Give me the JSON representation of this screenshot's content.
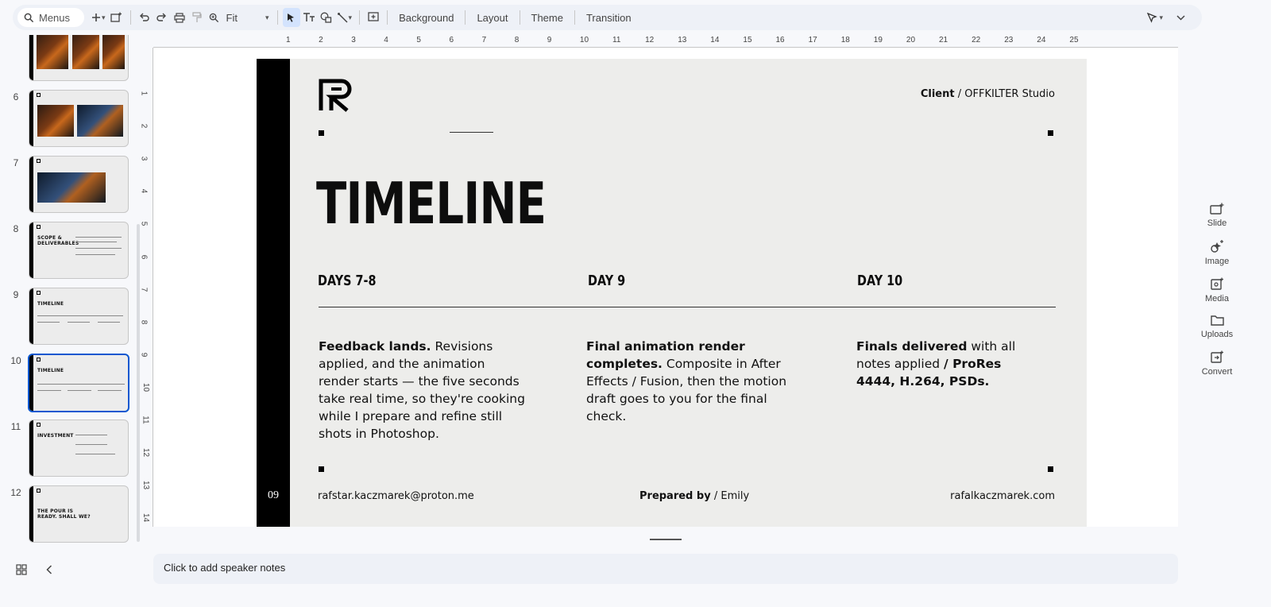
{
  "toolbar": {
    "search_label": "Menus",
    "zoom_value": "Fit",
    "buttons": [
      "Background",
      "Layout",
      "Theme",
      "Transition"
    ]
  },
  "filmstrip": {
    "slides": [
      {
        "number": "",
        "title": ""
      },
      {
        "number": "6",
        "title": ""
      },
      {
        "number": "7",
        "title": ""
      },
      {
        "number": "8",
        "title": "SCOPE & DELIVERABLES"
      },
      {
        "number": "9",
        "title": "TIMELINE"
      },
      {
        "number": "10",
        "title": "TIMELINE"
      },
      {
        "number": "11",
        "title": "INVESTMENT"
      },
      {
        "number": "12",
        "title": "THE POUR IS READY. SHALL WE?"
      }
    ],
    "selected_index": 5
  },
  "ruler": {
    "h": [
      "1",
      "2",
      "3",
      "4",
      "5",
      "6",
      "7",
      "8",
      "9",
      "10",
      "11",
      "12",
      "13",
      "14",
      "15",
      "16",
      "17",
      "18",
      "19",
      "20",
      "21",
      "22",
      "23",
      "24",
      "25"
    ],
    "v": [
      "1",
      "2",
      "3",
      "4",
      "5",
      "6",
      "7",
      "8",
      "9",
      "10",
      "11",
      "12",
      "13",
      "14"
    ]
  },
  "slide": {
    "page_number": "09",
    "client_label": "Client",
    "client_sep": "/",
    "client_name": "OFFKILTER Studio",
    "title": "TIMELINE",
    "columns": [
      {
        "heading": "DAYS 7-8",
        "lead": "Feedback lands.",
        "body": " Revisions applied, and the animation render starts — the five seconds take real time, so they're cooking while I prepare and refine still shots in Photoshop.",
        "tail": ""
      },
      {
        "heading": "DAY 9",
        "lead": "Final animation render completes.",
        "body": " Composite in After Effects / Fusion, then the motion draft goes to you for the final check.",
        "tail": ""
      },
      {
        "heading": "DAY 10",
        "lead": "Finals delivered",
        "body": " with all notes applied ",
        "tail": "/ ProRes 4444, H.264, PSDs."
      }
    ],
    "footer": {
      "email": "rafstar.kaczmarek@proton.me",
      "prepared_label": "Prepared by",
      "prepared_sep": "/",
      "prepared_name": "Emily",
      "website": "rafalkaczmarek.com"
    }
  },
  "notes": {
    "placeholder": "Click to add speaker notes"
  },
  "right_panel": [
    "Slide",
    "Image",
    "Media",
    "Uploads",
    "Convert"
  ],
  "colors": {
    "selection": "#0b57d0",
    "slide_bg": "#ededeb",
    "side_bar": "#000000"
  }
}
